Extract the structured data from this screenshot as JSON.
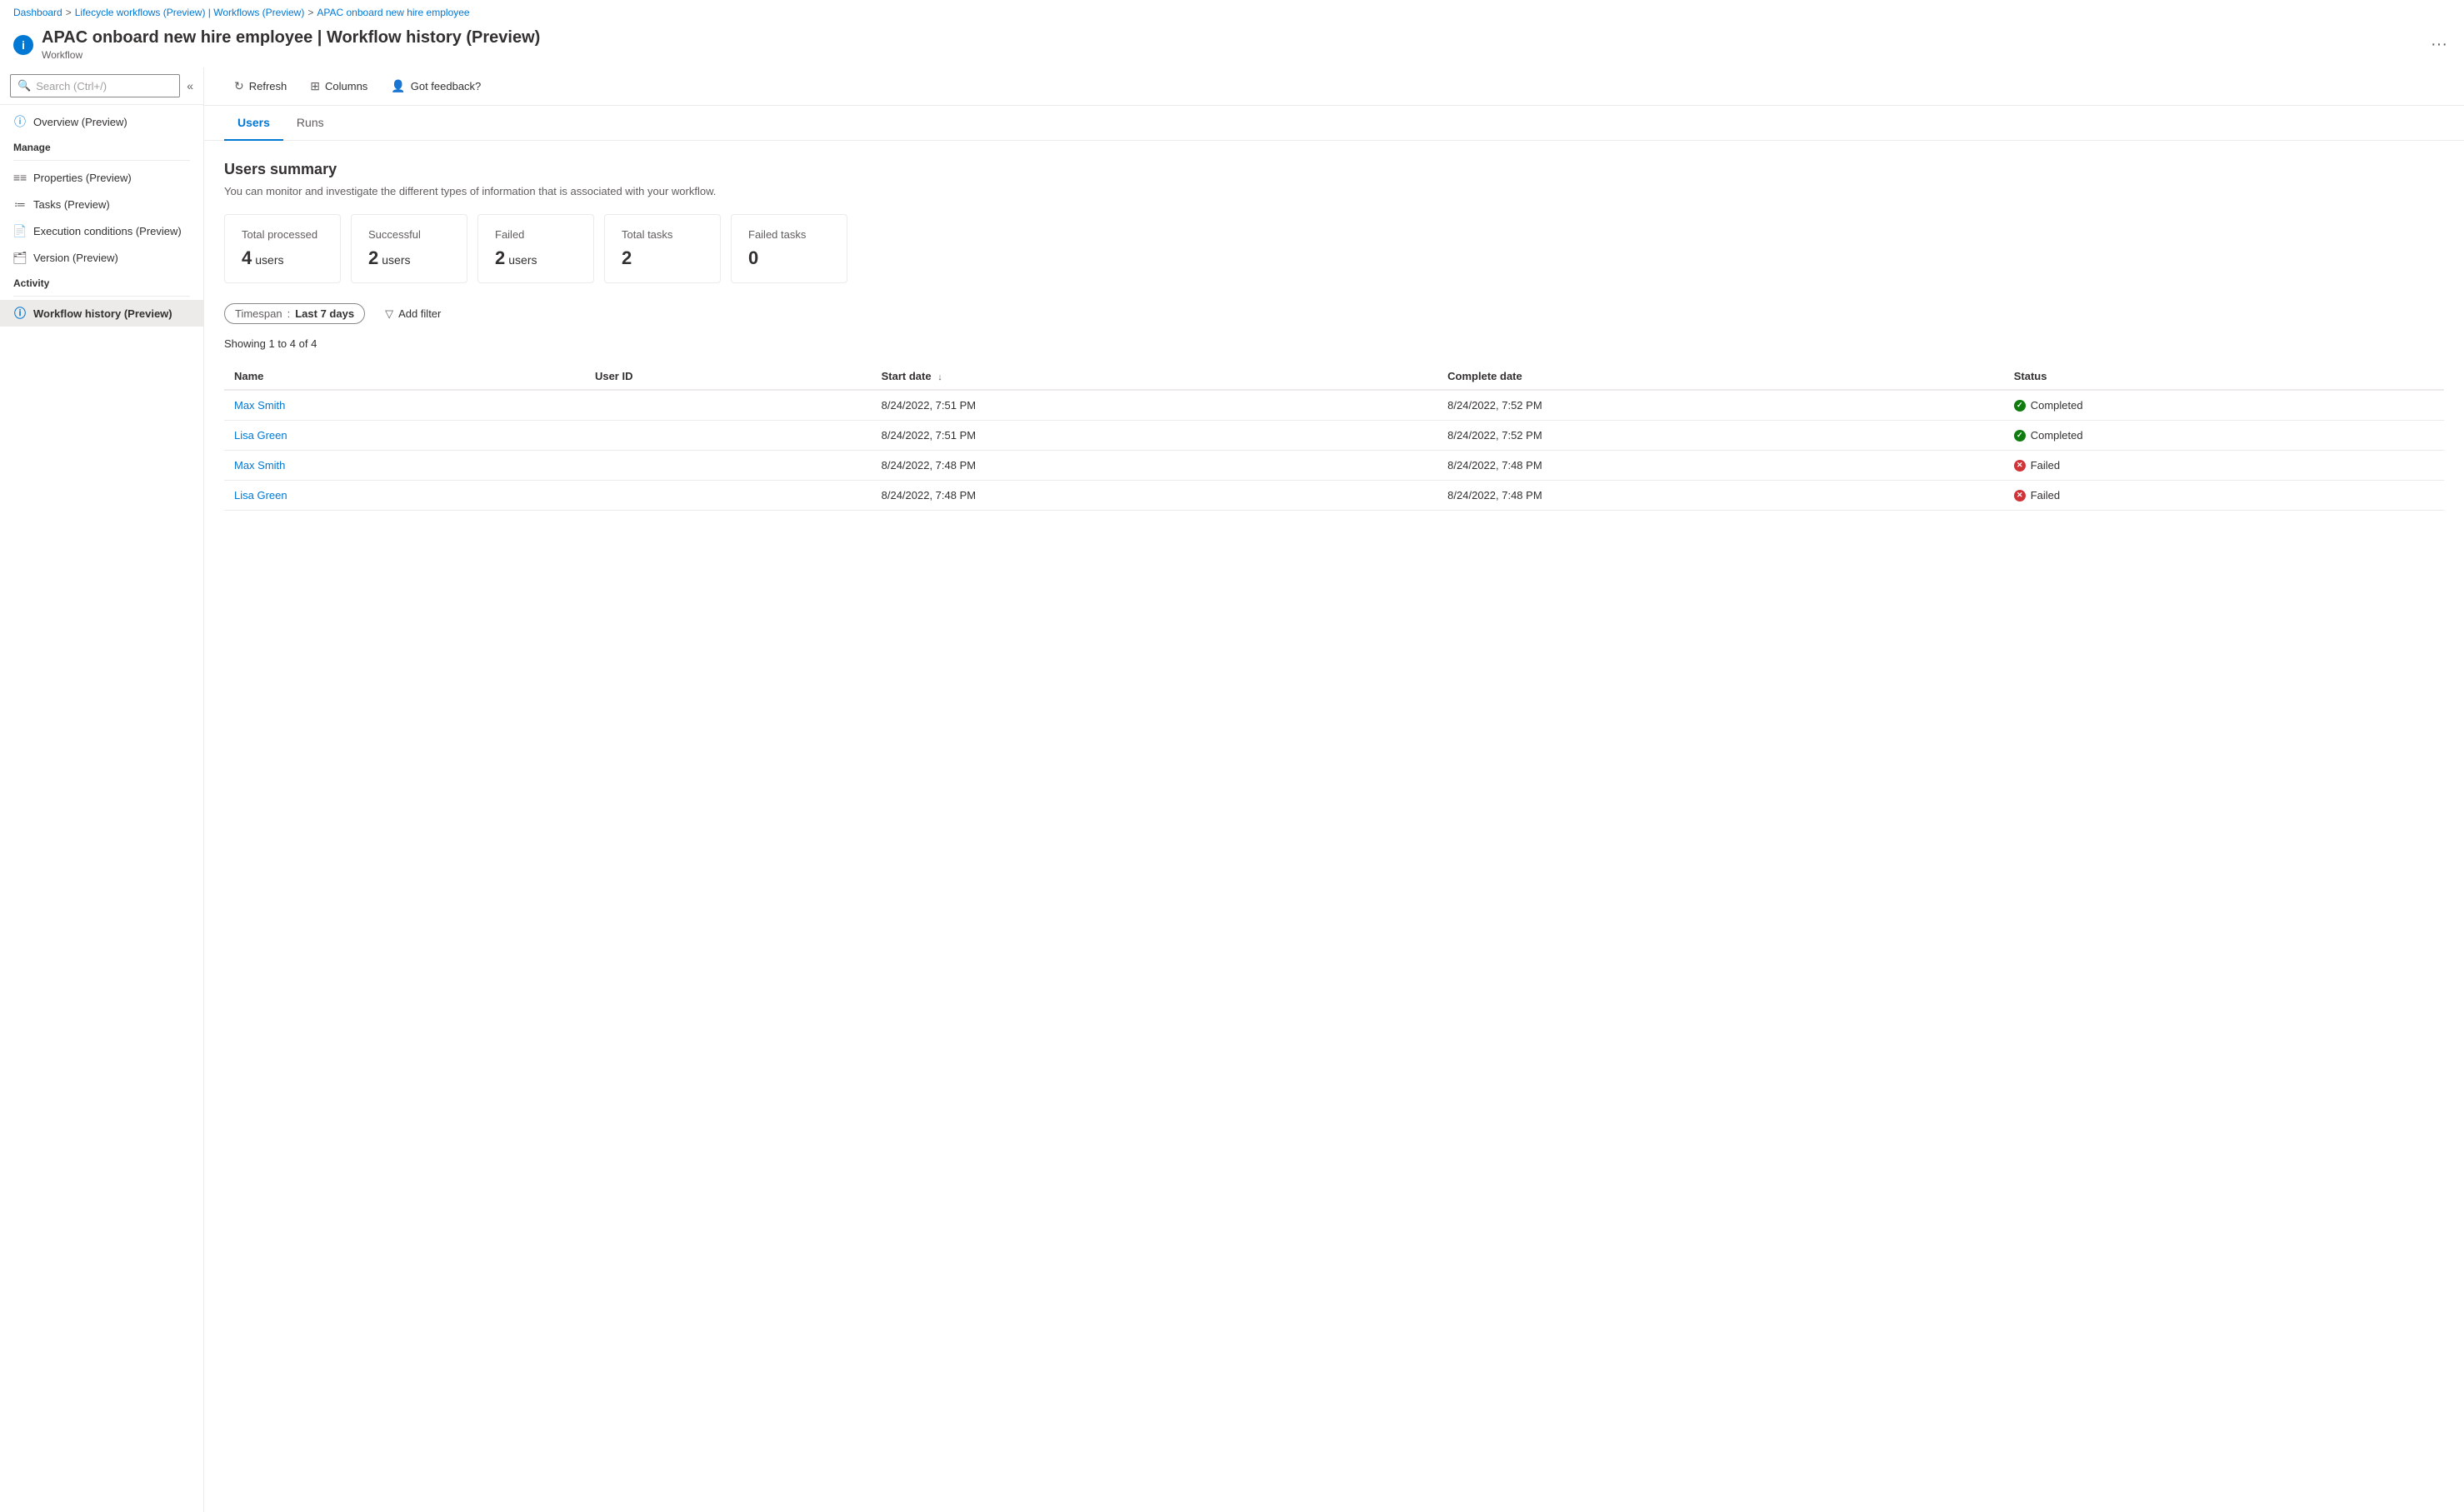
{
  "breadcrumb": {
    "items": [
      {
        "label": "Dashboard",
        "link": true
      },
      {
        "label": "Lifecycle workflows (Preview) | Workflows (Preview)",
        "link": true
      },
      {
        "label": "APAC onboard new hire employee",
        "link": true
      }
    ],
    "separators": [
      ">",
      ">"
    ]
  },
  "pageHeader": {
    "title": "APAC onboard new hire employee | Workflow history (Preview)",
    "subtitle": "Workflow",
    "moreLabel": "···",
    "infoIcon": "i"
  },
  "sidebar": {
    "searchPlaceholder": "Search (Ctrl+/)",
    "collapseIcon": "«",
    "overview": "Overview (Preview)",
    "manageLabel": "Manage",
    "manageItems": [
      {
        "label": "Properties (Preview)",
        "icon": "bar-chart"
      },
      {
        "label": "Tasks (Preview)",
        "icon": "list"
      },
      {
        "label": "Execution conditions (Preview)",
        "icon": "doc"
      },
      {
        "label": "Version (Preview)",
        "icon": "layers"
      }
    ],
    "activityLabel": "Activity",
    "activityItems": [
      {
        "label": "Workflow history (Preview)",
        "icon": "info",
        "active": true
      }
    ]
  },
  "toolbar": {
    "refreshLabel": "Refresh",
    "columnsLabel": "Columns",
    "feedbackLabel": "Got feedback?"
  },
  "tabs": [
    {
      "label": "Users",
      "active": true
    },
    {
      "label": "Runs",
      "active": false
    }
  ],
  "summary": {
    "title": "Users summary",
    "description": "You can monitor and investigate the different types of information that is associated with your workflow.",
    "stats": [
      {
        "label": "Total processed",
        "value": "4",
        "unit": "users"
      },
      {
        "label": "Successful",
        "value": "2",
        "unit": "users"
      },
      {
        "label": "Failed",
        "value": "2",
        "unit": "users"
      },
      {
        "label": "Total tasks",
        "value": "2",
        "unit": ""
      },
      {
        "label": "Failed tasks",
        "value": "0",
        "unit": ""
      }
    ]
  },
  "filters": {
    "timespanLabel": "Timespan",
    "timespanValue": "Last 7 days",
    "addFilterLabel": "Add filter"
  },
  "table": {
    "showingText": "Showing 1 to 4 of 4",
    "columns": [
      {
        "label": "Name"
      },
      {
        "label": "User ID"
      },
      {
        "label": "Start date",
        "sort": "↓"
      },
      {
        "label": "Complete date"
      },
      {
        "label": "Status"
      }
    ],
    "rows": [
      {
        "name": "Max Smith",
        "userId": "",
        "startDate": "8/24/2022, 7:51 PM",
        "completeDate": "8/24/2022, 7:52 PM",
        "status": "Completed",
        "statusType": "completed"
      },
      {
        "name": "Lisa Green",
        "userId": "",
        "startDate": "8/24/2022, 7:51 PM",
        "completeDate": "8/24/2022, 7:52 PM",
        "status": "Completed",
        "statusType": "completed"
      },
      {
        "name": "Max Smith",
        "userId": "",
        "startDate": "8/24/2022, 7:48 PM",
        "completeDate": "8/24/2022, 7:48 PM",
        "status": "Failed",
        "statusType": "failed"
      },
      {
        "name": "Lisa Green",
        "userId": "",
        "startDate": "8/24/2022, 7:48 PM",
        "completeDate": "8/24/2022, 7:48 PM",
        "status": "Failed",
        "statusType": "failed"
      }
    ]
  }
}
